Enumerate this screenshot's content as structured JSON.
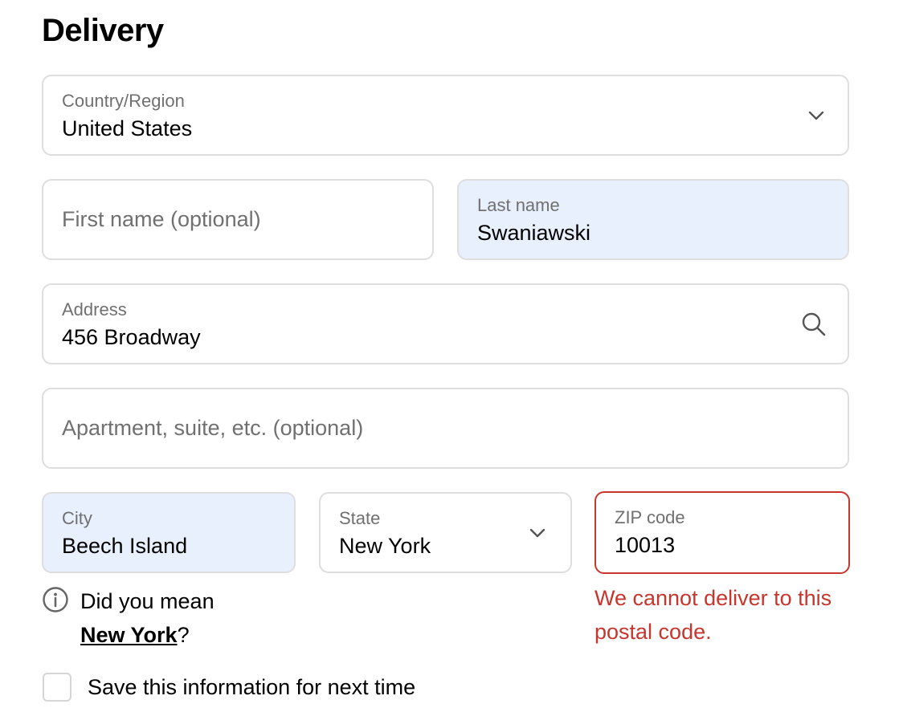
{
  "section": {
    "title": "Delivery"
  },
  "country": {
    "label": "Country/Region",
    "value": "United States"
  },
  "first_name": {
    "placeholder": "First name (optional)"
  },
  "last_name": {
    "label": "Last name",
    "value": "Swaniawski"
  },
  "address": {
    "label": "Address",
    "value": "456 Broadway"
  },
  "apartment": {
    "placeholder": "Apartment, suite, etc. (optional)"
  },
  "city": {
    "label": "City",
    "value": "Beech Island"
  },
  "state": {
    "label": "State",
    "value": "New York"
  },
  "zip": {
    "label": "ZIP code",
    "value": "10013"
  },
  "city_hint": {
    "prefix": "Did you mean",
    "suggestion": "New York",
    "suffix": "?"
  },
  "zip_error": {
    "message": "We cannot deliver to this postal code."
  },
  "save_info": {
    "label": "Save this information for next time",
    "checked": false
  },
  "colors": {
    "autofill_background": "#e8f0fe",
    "error": "#c8352c",
    "border": "#dedede",
    "muted_text": "#707070"
  },
  "icons": {
    "country_dropdown": "chevron-down-icon",
    "address_search": "search-icon",
    "state_dropdown": "chevron-down-icon",
    "hint": "info-icon"
  }
}
